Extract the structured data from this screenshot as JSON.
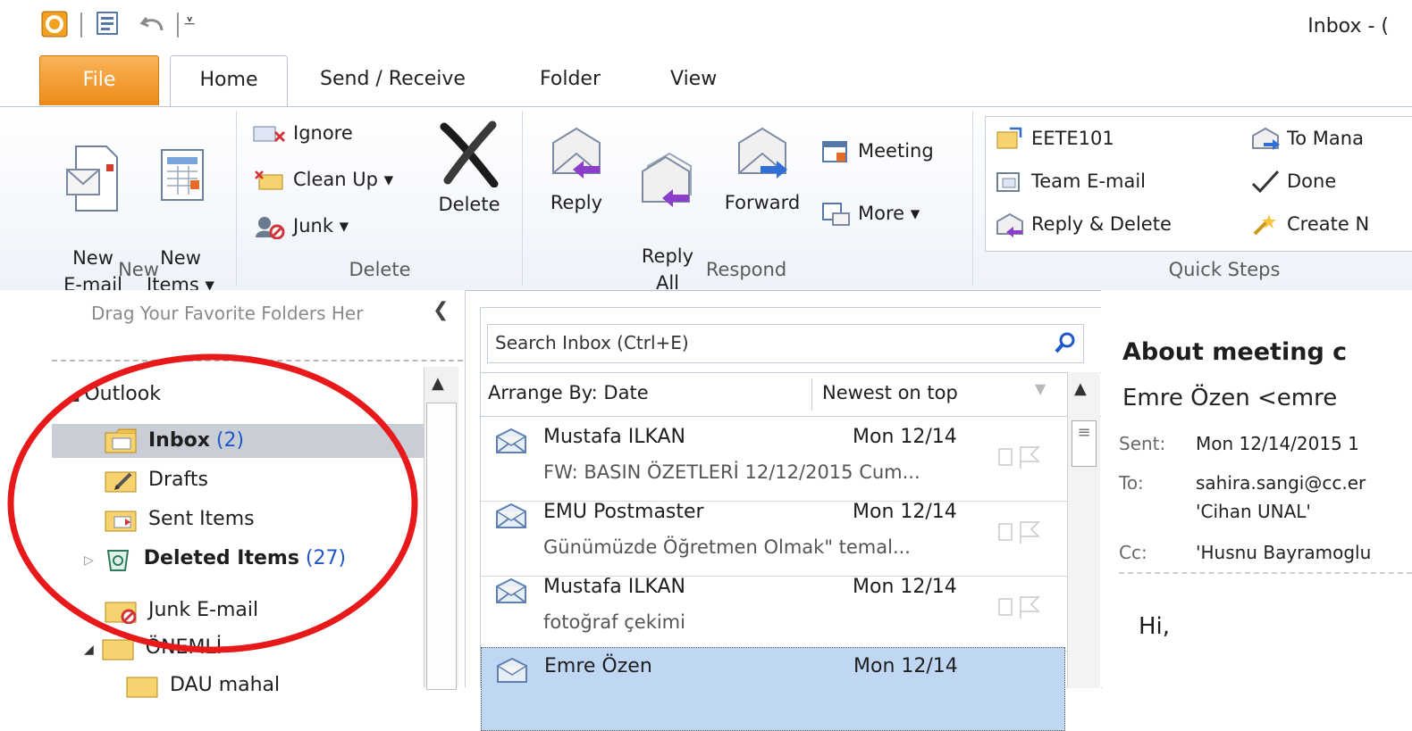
{
  "window": {
    "title": "Inbox - ("
  },
  "tabs": [
    {
      "label": "File"
    },
    {
      "label": "Home"
    },
    {
      "label": "Send / Receive"
    },
    {
      "label": "Folder"
    },
    {
      "label": "View"
    }
  ],
  "ribbon": {
    "new_group": {
      "label": "New",
      "new_email": "New\nE-mail",
      "new_items": "New\nItems ▾"
    },
    "delete_group": {
      "label": "Delete",
      "ignore": "Ignore",
      "clean_up": "Clean Up ▾",
      "junk": "Junk ▾",
      "delete": "Delete"
    },
    "respond_group": {
      "label": "Respond",
      "reply": "Reply",
      "reply_all": "Reply\nAll",
      "forward": "Forward",
      "meeting": "Meeting",
      "more": "More ▾"
    },
    "quick_steps_group": {
      "label": "Quick Steps",
      "items": [
        "EETE101",
        "Team E-mail",
        "Reply & Delete",
        "To Mana",
        "Done",
        "Create N"
      ]
    }
  },
  "nav": {
    "favorites_hint": "Drag Your Favorite Folders Her",
    "account": "Outlook",
    "folders": [
      {
        "name": "Inbox",
        "count": "(2)"
      },
      {
        "name": "Drafts",
        "count": ""
      },
      {
        "name": "Sent Items",
        "count": ""
      },
      {
        "name": "Deleted Items",
        "count": "(27)"
      },
      {
        "name": "Junk E-mail",
        "count": ""
      },
      {
        "name": "ÖNEMLİ",
        "count": ""
      },
      {
        "name": "DAU mahal",
        "count": ""
      }
    ]
  },
  "list": {
    "search_placeholder": "Search Inbox (Ctrl+E)",
    "arrange_by": "Arrange By: Date",
    "sort_order": "Newest on top",
    "messages": [
      {
        "from": "Mustafa ILKAN",
        "date": "Mon 12/14",
        "subject": "FW: BASIN ÖZETLERİ 12/12/2015 Cum..."
      },
      {
        "from": "EMU Postmaster",
        "date": "Mon 12/14",
        "subject": "Günümüzde Öğretmen Olmak\" temal..."
      },
      {
        "from": "Mustafa ILKAN",
        "date": "Mon 12/14",
        "subject": "fotoğraf çekimi"
      },
      {
        "from": "Emre Özen",
        "date": "Mon 12/14",
        "subject": ""
      }
    ]
  },
  "reading": {
    "subject": "About meeting c",
    "from": "Emre Özen <emre",
    "sent_label": "Sent:",
    "sent_value": "Mon 12/14/2015 1",
    "to_label": "To:",
    "to_value_1": "sahira.sangi@cc.er",
    "to_value_2": "'Cihan UNAL'",
    "cc_label": "Cc:",
    "cc_value": "'Husnu Bayramoglu",
    "body": "Hi,"
  },
  "annotation": {
    "color": "#e8191b"
  }
}
